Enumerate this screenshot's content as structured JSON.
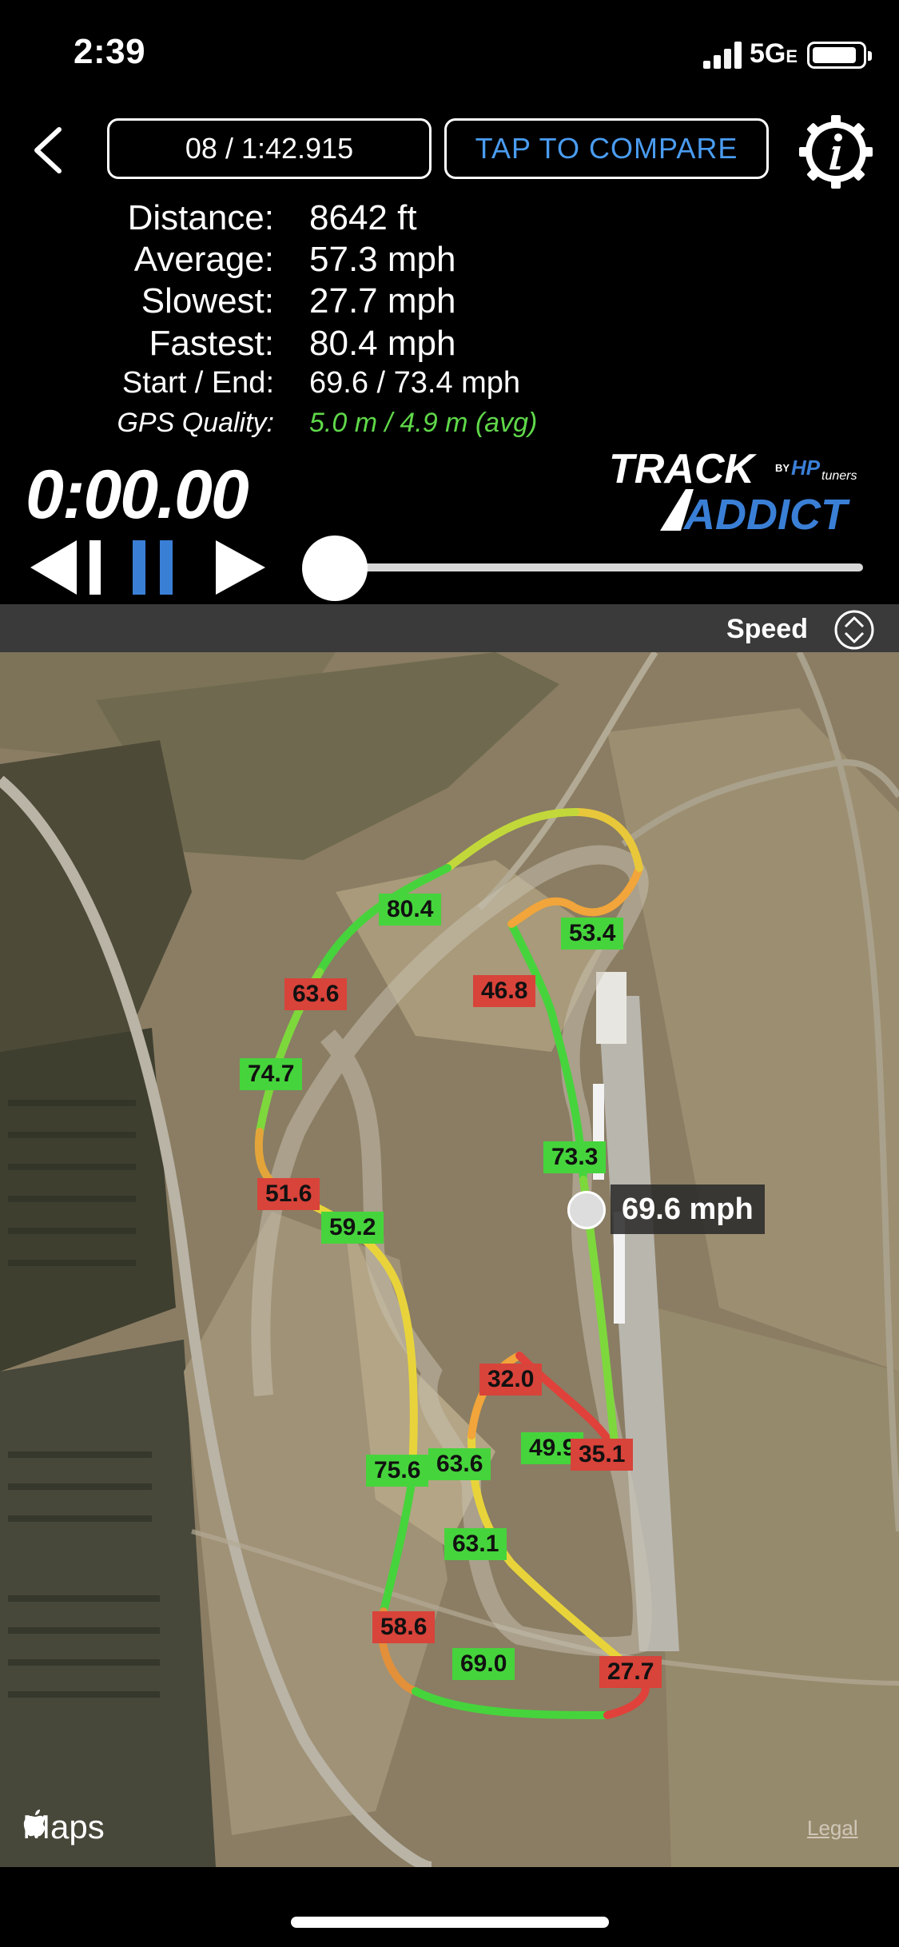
{
  "status_bar": {
    "time": "2:39",
    "network": "5G",
    "network_suffix": "E"
  },
  "header": {
    "lap_label": "08 / 1:42.915",
    "compare_label": "TAP TO COMPARE",
    "back_icon": "chevron-left-icon",
    "info_icon": "gear-info-icon"
  },
  "stats": [
    {
      "label": "Distance:",
      "value": "8642 ft"
    },
    {
      "label": "Average:",
      "value": "57.3 mph"
    },
    {
      "label": "Slowest:",
      "value": "27.7 mph"
    },
    {
      "label": "Fastest:",
      "value": "80.4 mph"
    },
    {
      "label": "Start / End:",
      "value": "69.6 / 73.4 mph"
    },
    {
      "label": "GPS Quality:",
      "value": "5.0 m / 4.9 m (avg)"
    }
  ],
  "timer": "0:00.00",
  "logo": {
    "line1": "TRACK",
    "by": "BY",
    "brand": "HP",
    "brand2": "tuners",
    "line2": "ADDICT"
  },
  "playback": {
    "position_fraction": 0.0
  },
  "map_header": {
    "label": "Speed",
    "icon": "up-down-toggle-icon"
  },
  "map": {
    "callout": "69.6 mph",
    "attribution": "Maps",
    "legal": "Legal",
    "markers": [
      {
        "value": "80.4",
        "level": "green"
      },
      {
        "value": "53.4",
        "level": "green"
      },
      {
        "value": "63.6",
        "level": "red"
      },
      {
        "value": "46.8",
        "level": "red"
      },
      {
        "value": "74.7",
        "level": "green"
      },
      {
        "value": "73.3",
        "level": "green"
      },
      {
        "value": "51.6",
        "level": "red"
      },
      {
        "value": "59.2",
        "level": "green"
      },
      {
        "value": "32.0",
        "level": "red"
      },
      {
        "value": "49.9",
        "level": "green"
      },
      {
        "value": "35.1",
        "level": "red"
      },
      {
        "value": "75.6",
        "level": "green"
      },
      {
        "value": "63.6",
        "level": "green"
      },
      {
        "value": "63.1",
        "level": "green"
      },
      {
        "value": "58.6",
        "level": "red"
      },
      {
        "value": "69.0",
        "level": "green"
      },
      {
        "value": "27.7",
        "level": "red"
      }
    ]
  }
}
